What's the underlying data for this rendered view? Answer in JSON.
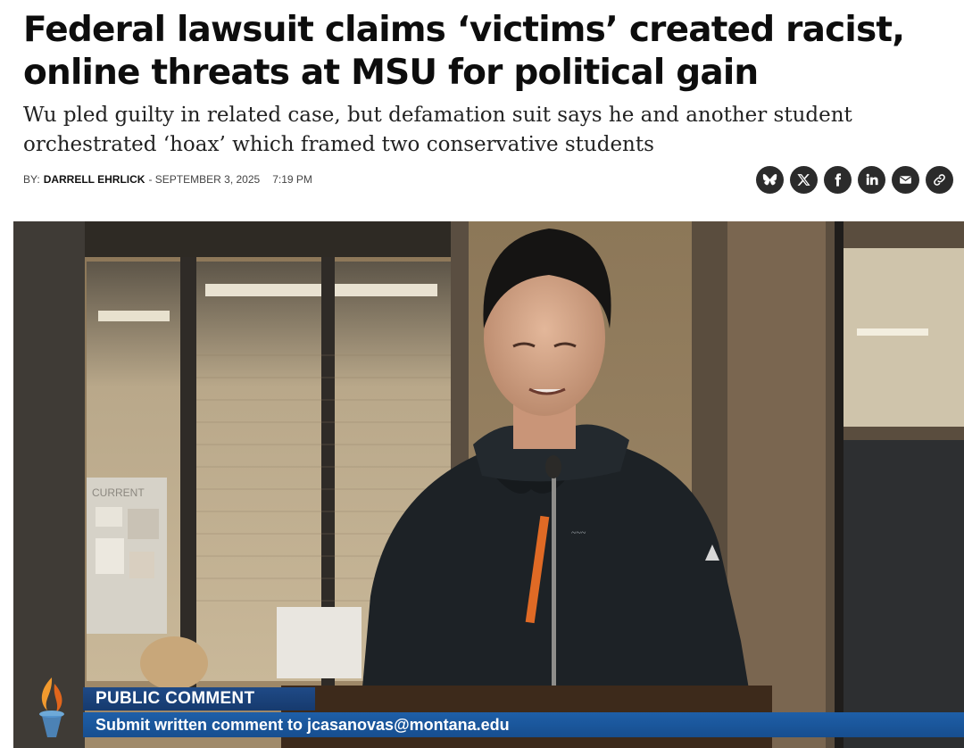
{
  "article": {
    "headline_line1": "Federal lawsuit claims ‘victims’ created racist,",
    "headline_line2": "online threats at MSU for political gain",
    "subhead_line1": "Wu pled guilty in related case, but defamation suit says he and another student",
    "subhead_line2": "orchestrated ‘hoax’ which framed two conservative students",
    "byline_prefix": "BY:",
    "author": "DARRELL EHRLICK",
    "date": "- SEPTEMBER 3, 2025",
    "time": "7:19 PM"
  },
  "share": {
    "icons": [
      "bluesky-icon",
      "x-icon",
      "facebook-icon",
      "linkedin-icon",
      "email-icon",
      "link-icon"
    ]
  },
  "photo": {
    "board_sign": "CURRENT",
    "lower_third_title": "PUBLIC COMMENT",
    "lower_third_text": "Submit written comment to jcasanovas@montana.edu",
    "colors": {
      "bar_title": "#1f4a86",
      "bar_text": "#1e5fa8",
      "torch": "#e87a1e"
    }
  }
}
